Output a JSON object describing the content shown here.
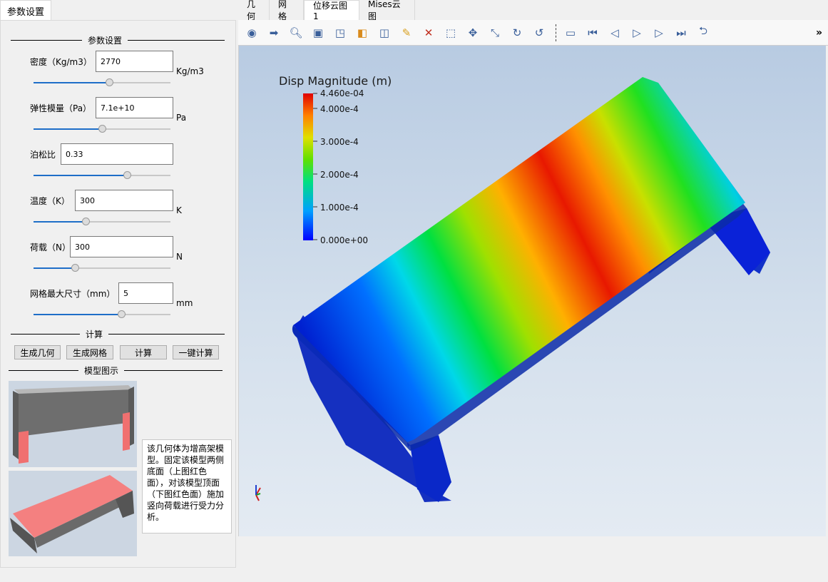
{
  "left_tab": "参数设置",
  "top_tabs": [
    "几何",
    "网格",
    "位移云图1",
    "Mises云图"
  ],
  "params_group": {
    "title": "参数设置",
    "density": {
      "label": "密度（Kg/m3）",
      "value": "2770",
      "unit": "Kg/m3",
      "slider": 0.55
    },
    "modulus": {
      "label": "弹性模量（Pa）",
      "value": "7.1e+10",
      "unit": "Pa",
      "slider": 0.5
    },
    "poisson": {
      "label": "泊松比",
      "value": "0.33",
      "unit": "",
      "slider": 0.68
    },
    "temperature": {
      "label": "温度（K）",
      "value": "300",
      "unit": "K",
      "slider": 0.38
    },
    "load": {
      "label": "荷载（N）",
      "value": "300",
      "unit": "N",
      "slider": 0.3
    },
    "mesh": {
      "label": "网格最大尺寸（mm）",
      "value": "5",
      "unit": "mm",
      "slider": 0.64
    }
  },
  "calc_group": {
    "title": "计算",
    "buttons": [
      "生成几何",
      "生成网格",
      "计算",
      "一键计算"
    ]
  },
  "model_group": {
    "title": "模型图示",
    "description": "该几何体为增高架模型。固定该模型两侧底面（上图红色面），对该模型顶面（下图红色面）施加竖向荷载进行受力分析。"
  },
  "legend": {
    "title": "Disp Magnitude (m)",
    "labels": [
      "4.460e-04",
      "4.000e-4",
      "3.000e-4",
      "2.000e-4",
      "1.000e-4",
      "0.000e+00"
    ]
  },
  "toolbar": {
    "more": "»",
    "icons": [
      "camera-icon",
      "export-icon",
      "zoom-select-icon",
      "reset-camera-icon",
      "box-icon",
      "component-icon",
      "surface-icon",
      "brush-icon",
      "delete-icon",
      "zoom-box-icon",
      "zoom-fit-icon",
      "axes-icon",
      "rotate-cw-icon",
      "rotate-ccw-icon",
      "video-icon",
      "first-frame-icon",
      "prev-frame-icon",
      "play-icon",
      "next-frame-icon",
      "last-frame-icon",
      "loop-icon"
    ]
  }
}
